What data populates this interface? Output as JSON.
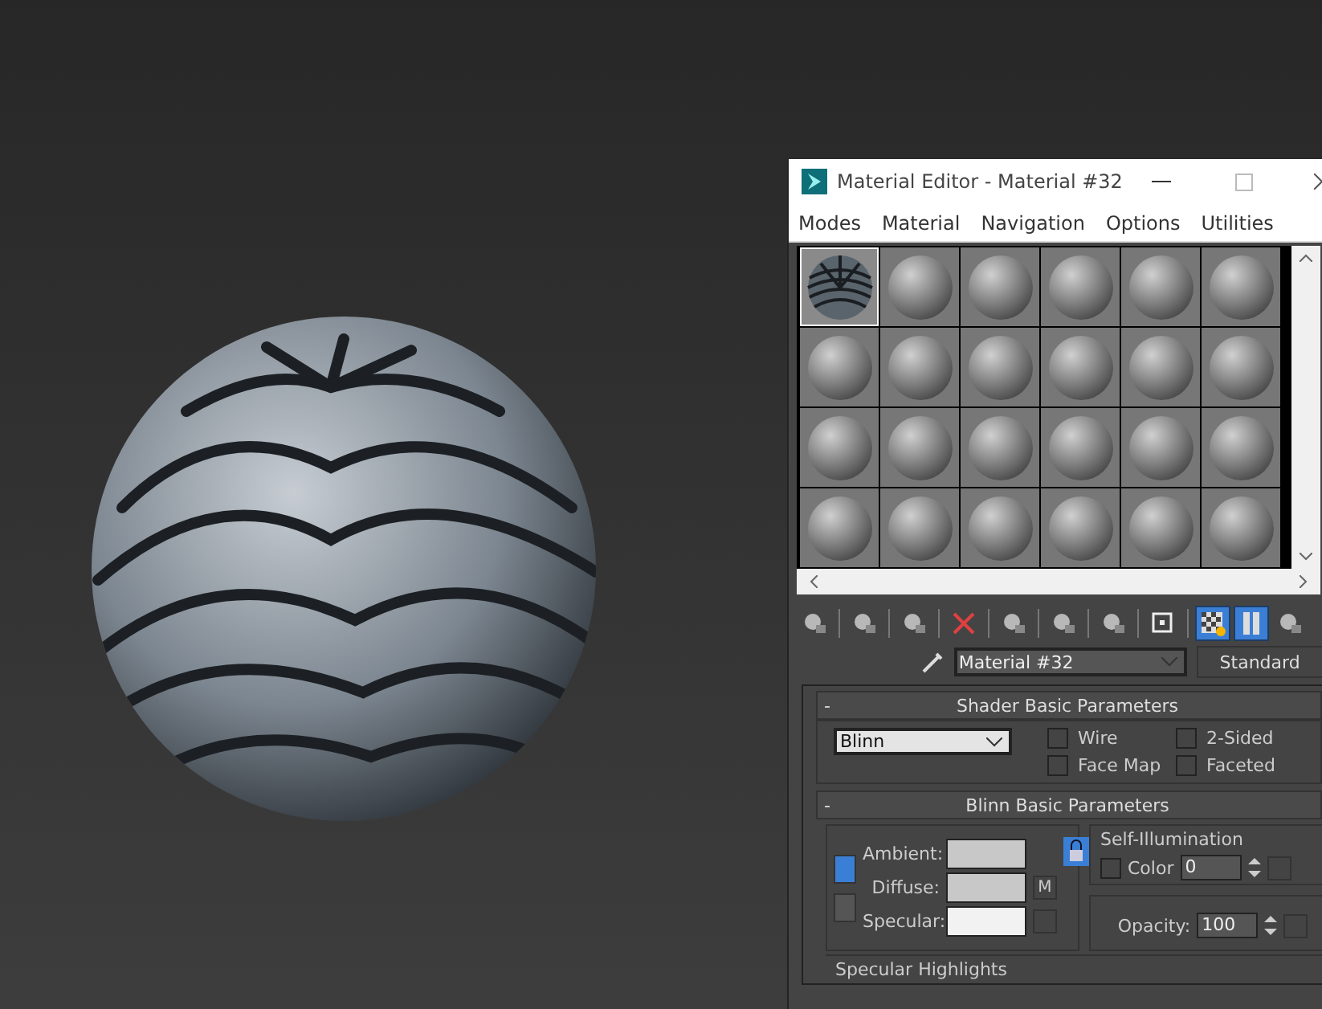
{
  "window": {
    "title": "Material Editor - Material #32"
  },
  "menu": [
    "Modes",
    "Material",
    "Navigation",
    "Options",
    "Utilities"
  ],
  "slots": [
    {
      "kind": "textured",
      "selected": true
    },
    {
      "kind": "default",
      "selected": false
    },
    {
      "kind": "default",
      "selected": false
    },
    {
      "kind": "default",
      "selected": false
    },
    {
      "kind": "default",
      "selected": false
    },
    {
      "kind": "default",
      "selected": false
    },
    {
      "kind": "default",
      "selected": false
    },
    {
      "kind": "default",
      "selected": false
    },
    {
      "kind": "default",
      "selected": false
    },
    {
      "kind": "default",
      "selected": false
    },
    {
      "kind": "default",
      "selected": false
    },
    {
      "kind": "default",
      "selected": false
    },
    {
      "kind": "default",
      "selected": false
    },
    {
      "kind": "default",
      "selected": false
    },
    {
      "kind": "default",
      "selected": false
    },
    {
      "kind": "default",
      "selected": false
    },
    {
      "kind": "default",
      "selected": false
    },
    {
      "kind": "default",
      "selected": false
    },
    {
      "kind": "default",
      "selected": false
    },
    {
      "kind": "default",
      "selected": false
    },
    {
      "kind": "default",
      "selected": false
    },
    {
      "kind": "default",
      "selected": false
    },
    {
      "kind": "default",
      "selected": false
    },
    {
      "kind": "default",
      "selected": false
    }
  ],
  "toolbar": [
    {
      "active": false
    },
    {
      "active": false
    },
    {
      "active": false
    },
    {
      "active": false
    },
    {
      "active": false
    },
    {
      "active": false
    },
    {
      "active": false
    },
    {
      "active": false
    },
    {
      "active": true
    },
    {
      "active": true
    },
    {
      "active": false
    }
  ],
  "material_name": {
    "value": "Material #32"
  },
  "material_type": "Standard",
  "shader_rollout": {
    "title": "Shader Basic Parameters",
    "collapse": "-",
    "shader": "Blinn",
    "options": [
      {
        "label": "Wire",
        "checked": false
      },
      {
        "label": "2-Sided",
        "checked": false
      },
      {
        "label": "Face Map",
        "checked": false
      },
      {
        "label": "Faceted",
        "checked": false
      }
    ]
  },
  "blinn_rollout": {
    "title": "Blinn Basic Parameters",
    "collapse": "-",
    "lock_ambient_diffuse": {
      "active": true
    },
    "lock_diffuse_specular": {
      "active": false
    },
    "lock_padlock": {
      "active": true
    },
    "colors": [
      {
        "label": "Ambient:",
        "color": "#c8c8c8"
      },
      {
        "label": "Diffuse:",
        "color": "#c8c8c8"
      },
      {
        "label": "Specular:",
        "color": "#f2f2f2"
      }
    ],
    "diffuse_map": "M",
    "self_illumination": {
      "title": "Self-Illumination",
      "label": "Color",
      "checked": false,
      "value": "0"
    },
    "opacity": {
      "label": "Opacity:",
      "value": "100"
    },
    "specular_highlights": {
      "title": "Specular Highlights"
    }
  }
}
